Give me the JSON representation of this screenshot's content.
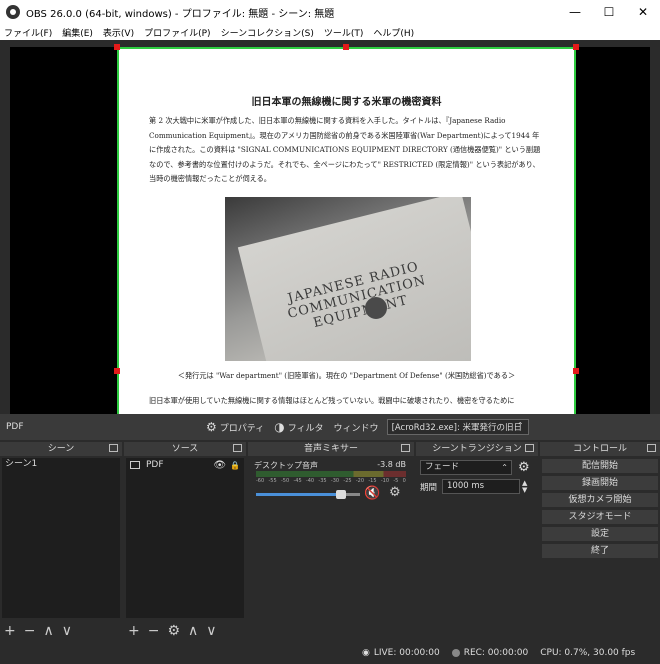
{
  "window": {
    "title": "OBS 26.0.0 (64-bit, windows) - プロファイル: 無題 - シーン: 無題",
    "minimize": "—",
    "maximize": "☐",
    "close": "✕"
  },
  "menu": [
    "ファイル(F)",
    "編集(E)",
    "表示(V)",
    "プロファイル(P)",
    "シーンコレクション(S)",
    "ツール(T)",
    "ヘルプ(H)"
  ],
  "document": {
    "title": "旧日本軍の無線機に関する米軍の機密資料",
    "paragraph": "第 2 次大戦中に米軍が作成した、旧日本軍の無線機に関する資料を入手した。タイトルは、『Japanese Radio Communication Equipment』。現在のアメリカ国防総省の前身である米国陸軍省(War Department)によって1944 年に作成された。この資料は \"SIGNAL COMMUNICATIONS EQUIPMENT DIRECTORY (通信機器便覧)\" という副題なので、参考書的な位置付けのようだ。それでも、全ページにわたって\" RESTRICTED (限定情報)\" という表記があり、当時の機密情報だったことが伺える。",
    "photo_text": "JAPANESE RADIO COMMUNICATION EQUIPMENT",
    "caption": "＜発行元は \"War department\" (旧陸軍省)。現在の \"Department Of Defense\" (米国防総省)である＞",
    "paragraph2": "旧日本軍が使用していた無線機に関する情報はほとんど残っていない。戦闘中に破壊されたり、機密を守るために"
  },
  "source_bar": {
    "source_name": "PDF",
    "properties": "プロパティ",
    "filters": "フィルタ",
    "window_label": "ウィンドウ",
    "window_value": "[AcroRd32.exe]: 米軍発行の旧日"
  },
  "scenes": {
    "title": "シーン",
    "items": [
      "シーン1"
    ]
  },
  "sources": {
    "title": "ソース",
    "items": [
      "PDF"
    ]
  },
  "mixer": {
    "title": "音声ミキサー",
    "channel_name": "デスクトップ音声",
    "channel_db": "-3.8 dB",
    "ticks": [
      "-60",
      "-55",
      "-50",
      "-45",
      "-40",
      "-35",
      "-30",
      "-25",
      "-20",
      "-15",
      "-10",
      "-5",
      "0"
    ],
    "volume": 0.82
  },
  "transitions": {
    "title": "シーントランジション",
    "selected": "フェード",
    "duration_label": "期間",
    "duration_value": "1000 ms"
  },
  "controls": {
    "title": "コントロール",
    "buttons": [
      "配信開始",
      "録画開始",
      "仮想カメラ開始",
      "スタジオモード",
      "設定",
      "終了"
    ]
  },
  "status": {
    "live": "LIVE: 00:00:00",
    "rec": "REC: 00:00:00",
    "cpu": "CPU: 0.7%, 30.00 fps"
  }
}
